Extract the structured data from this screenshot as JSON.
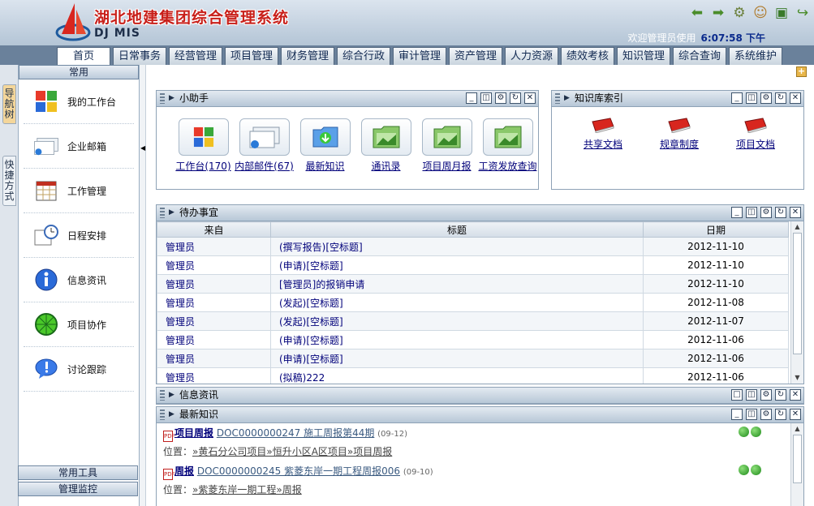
{
  "app": {
    "title": "湖北地建集团综合管理系统",
    "subtitle": "DJ MIS",
    "welcome": "欢迎管理员使用",
    "time": "6:07:58 下午"
  },
  "nav_tabs": [
    "首页",
    "日常事务",
    "经营管理",
    "项目管理",
    "财务管理",
    "综合行政",
    "审计管理",
    "资产管理",
    "人力资源",
    "绩效考核",
    "知识管理",
    "综合查询",
    "系统维护"
  ],
  "left_tabs": [
    "导航树",
    "快捷方式"
  ],
  "sidebar": {
    "section_top": "常用",
    "items": [
      {
        "label": "我的工作台",
        "icon": "workspace-icon"
      },
      {
        "label": "企业邮箱",
        "icon": "mail-icon"
      },
      {
        "label": "工作管理",
        "icon": "calendar-icon"
      },
      {
        "label": "日程安排",
        "icon": "schedule-icon"
      },
      {
        "label": "信息资讯",
        "icon": "info-icon"
      },
      {
        "label": "项目协作",
        "icon": "collaboration-icon"
      },
      {
        "label": "讨论跟踪",
        "icon": "discussion-icon"
      }
    ],
    "section_tools": "常用工具",
    "section_monitor": "管理监控"
  },
  "helper": {
    "title": "小助手",
    "items": [
      {
        "label": "工作台(170)",
        "icon": "workspace-icon"
      },
      {
        "label": "内部邮件(67)",
        "icon": "mail-icon"
      },
      {
        "label": "最新知识",
        "icon": "knowledge-icon"
      },
      {
        "label": "通讯录",
        "icon": "contacts-folder-icon"
      },
      {
        "label": "项目周月报",
        "icon": "report-folder-icon"
      },
      {
        "label": "工资发放查询",
        "icon": "salary-folder-icon"
      }
    ]
  },
  "knowledge_index": {
    "title": "知识库索引",
    "items": [
      {
        "label": "共享文档",
        "icon": "book-icon"
      },
      {
        "label": "规章制度",
        "icon": "book-icon"
      },
      {
        "label": "项目文档",
        "icon": "book-icon"
      }
    ]
  },
  "todo": {
    "title": "待办事宜",
    "columns": [
      "来自",
      "标题",
      "日期"
    ],
    "rows": [
      {
        "from": "管理员",
        "title": "(撰写报告)[空标题]",
        "date": "2012-11-10"
      },
      {
        "from": "管理员",
        "title": "(申请)[空标题]",
        "date": "2012-11-10"
      },
      {
        "from": "管理员",
        "title": "[管理员]的报销申请",
        "date": "2012-11-10"
      },
      {
        "from": "管理员",
        "title": "(发起)[空标题]",
        "date": "2012-11-08"
      },
      {
        "from": "管理员",
        "title": "(发起)[空标题]",
        "date": "2012-11-07"
      },
      {
        "from": "管理员",
        "title": "(申请)[空标题]",
        "date": "2012-11-06"
      },
      {
        "from": "管理员",
        "title": "(申请)[空标题]",
        "date": "2012-11-06"
      },
      {
        "from": "管理员",
        "title": "(拟稿)222",
        "date": "2012-11-06"
      }
    ]
  },
  "info_panel": {
    "title": "信息资讯"
  },
  "latest": {
    "title": "最新知识",
    "items": [
      {
        "kind": "项目周报",
        "doc": "DOC0000000247 施工周报第44期",
        "date": "(09-12)",
        "location_label": "位置：",
        "location": "»黄石分公司项目»恒升小区A区项目»项目周报"
      },
      {
        "kind": "周报",
        "doc": "DOC0000000245 紫菱东岸一期工程周报006",
        "date": "(09-10)",
        "location_label": "位置：",
        "location": "»紫菱东岸一期工程»周报"
      }
    ]
  }
}
